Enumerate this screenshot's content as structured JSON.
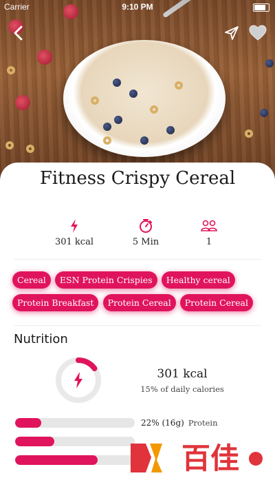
{
  "status_bar": {
    "carrier": "Carrier",
    "time": "9:10 PM"
  },
  "recipe": {
    "title": "Fitness Crispy Cereal",
    "stats": [
      {
        "icon": "lightning-icon",
        "value": "301 kcal"
      },
      {
        "icon": "stopwatch-icon",
        "value": "5 Min"
      },
      {
        "icon": "people-icon",
        "value": "1"
      }
    ],
    "tags": [
      "Cereal",
      "ESN Protein Crispies",
      "Healthy cereal",
      "Protein Breakfast",
      "Protein Cereal",
      "Protein Cereal"
    ]
  },
  "nutrition": {
    "heading": "Nutrition",
    "kcal": "301 kcal",
    "daily": "15% of daily calories",
    "daily_fraction": 0.15,
    "macros": [
      {
        "label": "22% (16g)",
        "name": "Protein",
        "fraction": 0.22
      },
      {
        "label": "",
        "name": "",
        "fraction": 0.33
      },
      {
        "label": "",
        "name": "",
        "fraction": 0.69
      }
    ]
  },
  "watermark": {
    "text": "百佳"
  },
  "colors": {
    "accent": "#e0145c"
  }
}
